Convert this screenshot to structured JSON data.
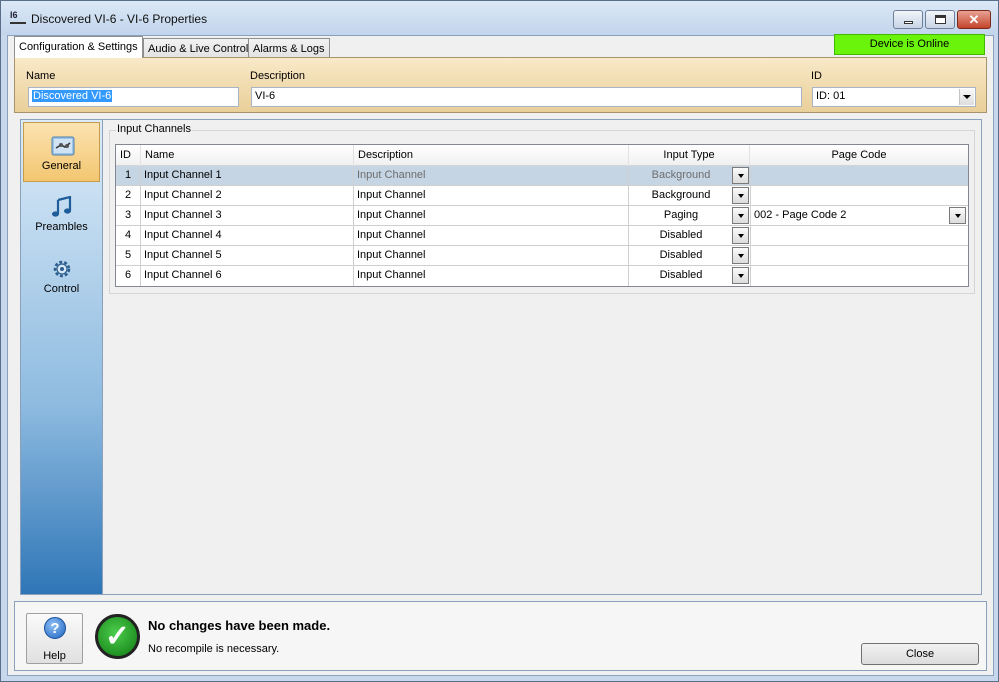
{
  "window": {
    "title": "Discovered VI-6 - VI-6 Properties",
    "icon_text": "I6"
  },
  "tabs": [
    {
      "label": "Configuration & Settings",
      "active": true
    },
    {
      "label": "Audio & Live Control",
      "active": false
    },
    {
      "label": "Alarms & Logs",
      "active": false
    }
  ],
  "status_badge": {
    "text": "Device is Online",
    "color": "#6af40c"
  },
  "header": {
    "name_label": "Name",
    "name_value": "Discovered VI-6",
    "description_label": "Description",
    "description_value": "VI-6",
    "id_label": "ID",
    "id_value": "ID: 01"
  },
  "sidebar": {
    "items": [
      {
        "label": "General",
        "icon": "general-settings-icon",
        "active": true
      },
      {
        "label": "Preambles",
        "icon": "music-note-icon",
        "active": false
      },
      {
        "label": "Control",
        "icon": "gear-icon",
        "active": false
      }
    ]
  },
  "input_channels": {
    "group_label": "Input Channels",
    "columns": [
      "ID",
      "Name",
      "Description",
      "Input Type",
      "Page Code"
    ],
    "rows": [
      {
        "id": "1",
        "name": "Input Channel 1",
        "description": "Input Channel",
        "input_type": "Background",
        "page_code": ""
      },
      {
        "id": "2",
        "name": "Input Channel 2",
        "description": "Input Channel",
        "input_type": "Background",
        "page_code": ""
      },
      {
        "id": "3",
        "name": "Input Channel 3",
        "description": "Input Channel",
        "input_type": "Paging",
        "page_code": "002 - Page Code 2"
      },
      {
        "id": "4",
        "name": "Input Channel 4",
        "description": "Input Channel",
        "input_type": "Disabled",
        "page_code": ""
      },
      {
        "id": "5",
        "name": "Input Channel 5",
        "description": "Input Channel",
        "input_type": "Disabled",
        "page_code": ""
      },
      {
        "id": "6",
        "name": "Input Channel 6",
        "description": "Input Channel",
        "input_type": "Disabled",
        "page_code": ""
      }
    ]
  },
  "footer": {
    "help_label": "Help",
    "status_title": "No changes have been made.",
    "status_detail": "No recompile is necessary.",
    "close_label": "Close"
  }
}
